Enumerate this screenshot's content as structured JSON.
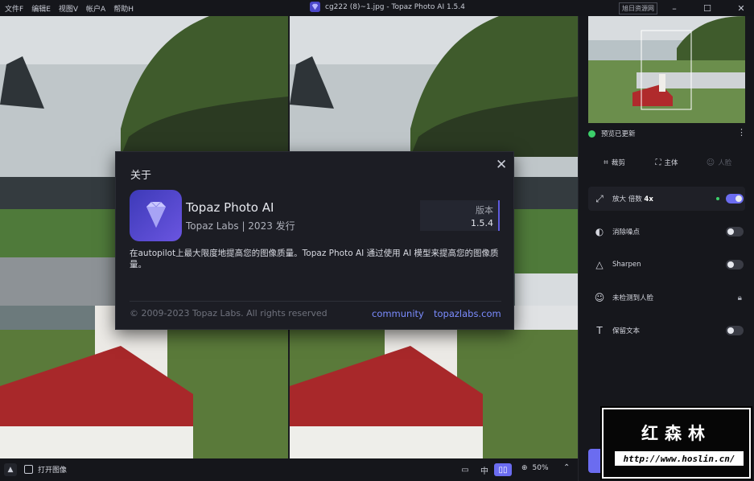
{
  "menu": [
    "文件F",
    "编辑E",
    "视图V",
    "帐户A",
    "帮助H"
  ],
  "window_title": "cg222 (8)~1.jpg - Topaz Photo AI 1.5.4",
  "mirror_label": "旭日资源网",
  "about": {
    "title": "关于",
    "app_name": "Topaz Photo AI",
    "company": "Topaz Labs | 2023 发行",
    "version_label": "版本",
    "version": "1.5.4",
    "description": "在autopilot上最大限度地提高您的图像质量。Topaz Photo AI 通过使用 AI 模型来提高您的图像质量。",
    "copyright": "© 2009-2023 Topaz Labs. All rights reserved",
    "link_community": "community",
    "link_site": "topazlabs.com"
  },
  "bottombar": {
    "open_label": "打开图像",
    "view_middle": "中",
    "zoom": "50%"
  },
  "panel": {
    "status": "预览已更新",
    "tools": [
      {
        "label": "裁剪",
        "icon": "crop-icon"
      },
      {
        "label": "主体",
        "icon": "subject-icon"
      },
      {
        "label": "人脸",
        "icon": "face-icon"
      }
    ],
    "upscale_label": "放大 倍数",
    "upscale_factor": "4x",
    "denoise_label": "消除噪点",
    "sharpen_label": "Sharpen",
    "face_label": "未检测到人脸",
    "text_label": "保留文本"
  },
  "watermark": {
    "name": "红森林",
    "url": "http://www.hoslin.cn/"
  },
  "colors": {
    "accent": "#6b6cf0",
    "link": "#7b8cff",
    "status_green": "#3ccf6a"
  }
}
